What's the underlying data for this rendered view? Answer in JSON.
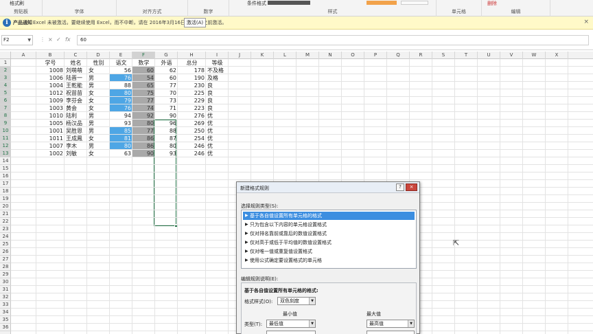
{
  "ribbon": {
    "format_painter": "格式刷",
    "cond_format": "条件格式",
    "delete_label": "删除",
    "groups": [
      "剪贴板",
      "字体",
      "对齐方式",
      "数字",
      "样式",
      "单元格",
      "编辑"
    ]
  },
  "message_bar": {
    "title": "产品通知",
    "text": "Excel 未被激活。要继续使用 Excel，而不中断，请在 2016年3月16日 星期三 之前激活。",
    "button": "激活(A)",
    "close": "×"
  },
  "formula_bar": {
    "name_box": "F2",
    "cancel_icon": "×",
    "enter_icon": "✓",
    "fx": "fx",
    "value": "60"
  },
  "columns": [
    "A",
    "B",
    "C",
    "D",
    "E",
    "F",
    "G",
    "H",
    "I",
    "J",
    "K",
    "L",
    "M",
    "N",
    "O",
    "P",
    "Q",
    "R",
    "S",
    "T",
    "U",
    "V",
    "W",
    "X"
  ],
  "selected_column": "F",
  "rows_count": 36,
  "table": {
    "headers": [
      "学号",
      "姓名",
      "性别",
      "语文",
      "数学",
      "外语",
      "总分",
      "等级"
    ],
    "rows": [
      [
        "1008",
        "刘萌萌",
        "女",
        "56",
        "60",
        "62",
        "178",
        "不及格"
      ],
      [
        "1006",
        "陆晋一",
        "男",
        "76",
        "54",
        "60",
        "190",
        "及格"
      ],
      [
        "1004",
        "王乾能",
        "男",
        "88",
        "65",
        "77",
        "230",
        "良"
      ],
      [
        "1012",
        "祝苗苗",
        "女",
        "80",
        "75",
        "70",
        "225",
        "良"
      ],
      [
        "1009",
        "李芬会",
        "女",
        "79",
        "77",
        "73",
        "229",
        "良"
      ],
      [
        "1003",
        "黄会",
        "女",
        "76",
        "74",
        "71",
        "223",
        "良"
      ],
      [
        "1010",
        "陆利",
        "男",
        "94",
        "92",
        "90",
        "276",
        "优"
      ],
      [
        "1005",
        "杨汉品",
        "男",
        "93",
        "80",
        "96",
        "269",
        "优"
      ],
      [
        "1001",
        "吴胜恩",
        "男",
        "85",
        "77",
        "88",
        "250",
        "优"
      ],
      [
        "1011",
        "王成鳳",
        "女",
        "81",
        "86",
        "87",
        "254",
        "优"
      ],
      [
        "1007",
        "李木",
        "男",
        "80",
        "86",
        "80",
        "246",
        "优"
      ],
      [
        "1002",
        "刘敏",
        "女",
        "63",
        "90",
        "93",
        "246",
        "优"
      ]
    ],
    "blue_rows_chinese": [
      1,
      3,
      4,
      5,
      8,
      9,
      10
    ]
  },
  "dialog": {
    "title": "新建格式规则",
    "help": "?",
    "close": "×",
    "select_type_label": "选择规则类型(S):",
    "rule_types": [
      "基于各自值设置所有单元格的格式",
      "只为包含以下内容的单元格设置格式",
      "仅对排名靠前或靠后的数值设置格式",
      "仅对高于或低于平均值的数值设置格式",
      "仅对唯一值或重复值设置格式",
      "使用公式确定要设置格式的单元格"
    ],
    "selected_rule": 0,
    "edit_label": "编辑规则说明(E):",
    "desc_title": "基于各自值设置所有单元格的格式:",
    "format_style_label": "格式样式(O):",
    "format_style_value": "双色刻度",
    "min_label": "最小值",
    "max_label": "最大值",
    "type_label": "类型(T):",
    "min_type": "最低值",
    "max_type": "最高值"
  }
}
